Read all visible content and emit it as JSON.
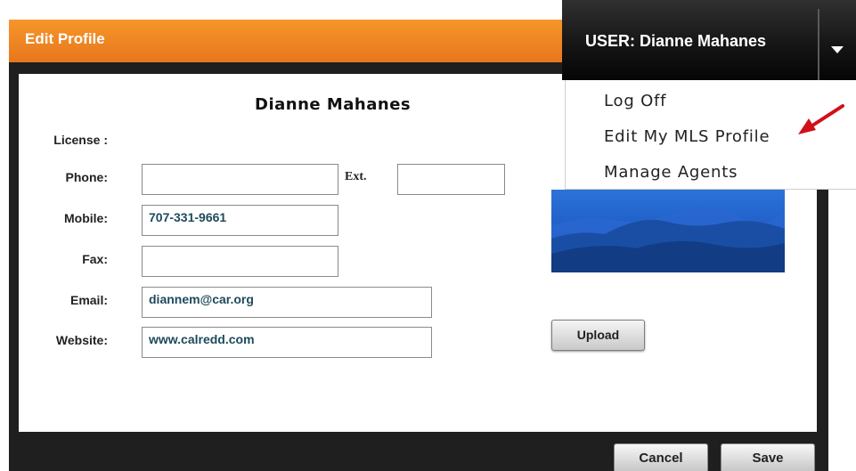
{
  "dialog": {
    "title": "Edit Profile",
    "profile_name": "Dianne Mahanes",
    "fields": {
      "license_label": "License :",
      "phone_label": "Phone:",
      "phone_value": "",
      "ext_label": "Ext.",
      "ext_value": "",
      "mobile_label": "Mobile:",
      "mobile_value": "707-331-9661",
      "fax_label": "Fax:",
      "fax_value": "",
      "email_label": "Email:",
      "email_value": "diannem@car.org",
      "website_label": "Website:",
      "website_value": "www.calredd.com"
    },
    "upload_label": "Upload",
    "cancel_label": "Cancel",
    "save_label": "Save"
  },
  "user_menu": {
    "user_label": "USER: Dianne  Mahanes",
    "items": [
      {
        "label": "Log Off"
      },
      {
        "label": "Edit My MLS Profile"
      },
      {
        "label": "Manage Agents"
      }
    ],
    "dropdown_icon": "caret-down-icon"
  },
  "colors": {
    "header_orange": "#f08a24",
    "dark_bar": "#161616",
    "photo_blue": "#1f5fc8",
    "annotation_arrow": "#d0101a"
  }
}
